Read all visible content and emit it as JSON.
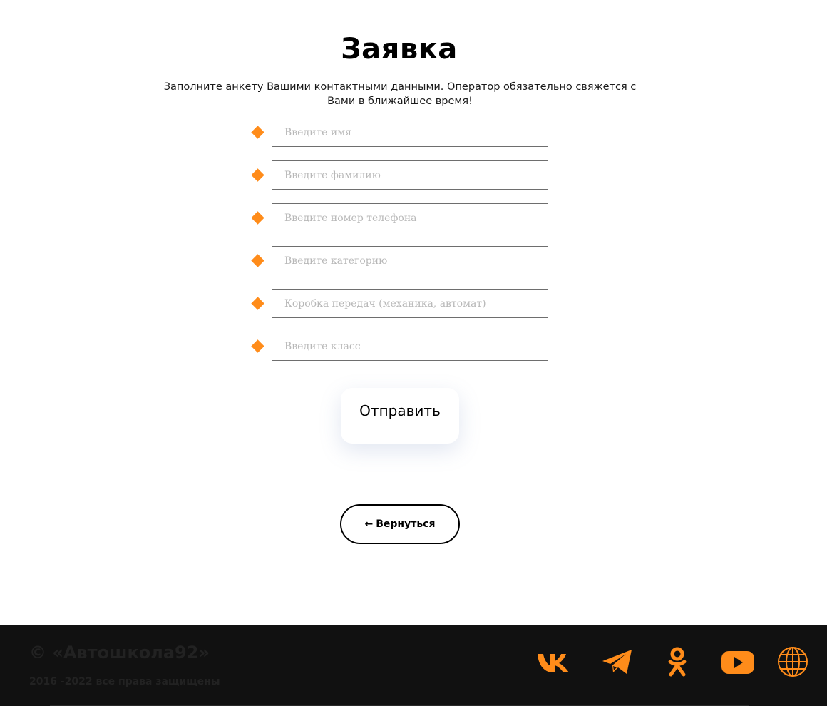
{
  "page": {
    "title": "Заявка",
    "subtitle": "Заполните анкету Вашими контактными данными. Оператор обязательно свяжется с Вами в ближайшее время!"
  },
  "form": {
    "fields": [
      {
        "placeholder": "Введите имя",
        "value": ""
      },
      {
        "placeholder": "Введите фамилию",
        "value": ""
      },
      {
        "placeholder": "Введите номер телефона",
        "value": ""
      },
      {
        "placeholder": "Введите категорию",
        "value": ""
      },
      {
        "placeholder": "Коробка передач (механика, автомат)",
        "value": ""
      },
      {
        "placeholder": "Введите класс",
        "value": ""
      }
    ],
    "field_marker_icon": "diamond-icon",
    "submit_label": "Отправить"
  },
  "back_button": {
    "arrow": "←",
    "label": "Вернуться"
  },
  "footer": {
    "copyright": "© «Автошкола92»",
    "rights": "2016 -2022 все права защищены",
    "social": [
      {
        "name": "vk-icon"
      },
      {
        "name": "telegram-icon"
      },
      {
        "name": "odnoklassniki-icon"
      },
      {
        "name": "youtube-icon"
      },
      {
        "name": "globe-icon"
      }
    ]
  },
  "colors": {
    "accent": "#ff8c1a",
    "footer_bg": "#111111",
    "footer_text": "#222222"
  }
}
